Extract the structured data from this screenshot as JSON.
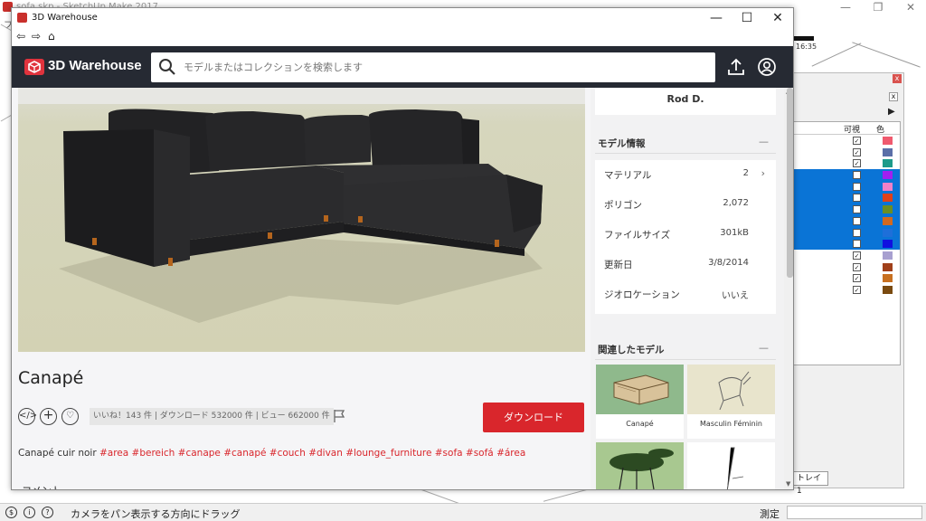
{
  "bg_app": {
    "title": "sofa.skp - SketchUp Make 2017",
    "menu_initial": "フ",
    "clock": "16:35",
    "controls": {
      "minimize": "—",
      "restore": "❐",
      "close": "✕"
    }
  },
  "tray": {
    "close": "x",
    "subclose": "x",
    "arrow": "▶",
    "col_visible": "可視",
    "col_color": "色",
    "tab_label": "トレイ 1",
    "layers": [
      {
        "visible": true,
        "color": "#f05a6e",
        "selected": false
      },
      {
        "visible": true,
        "color": "#5b6fa8",
        "selected": false
      },
      {
        "visible": true,
        "color": "#1e9b8a",
        "selected": false
      },
      {
        "visible": false,
        "color": "#a020f0",
        "selected": true
      },
      {
        "visible": false,
        "color": "#f080c8",
        "selected": true
      },
      {
        "visible": false,
        "color": "#e0401a",
        "selected": true
      },
      {
        "visible": false,
        "color": "#6b8e23",
        "selected": true
      },
      {
        "visible": false,
        "color": "#d2691e",
        "selected": true
      },
      {
        "visible": false,
        "color": "#1e6fd9",
        "selected": true
      },
      {
        "visible": false,
        "color": "#1010e0",
        "selected": true
      },
      {
        "visible": true,
        "color": "#a8a0d0",
        "selected": false
      },
      {
        "visible": true,
        "color": "#a0401a",
        "selected": false
      },
      {
        "visible": true,
        "color": "#c87020",
        "selected": false
      },
      {
        "visible": true,
        "color": "#7a4a10",
        "selected": false
      }
    ]
  },
  "statusbar": {
    "hint": "カメラをパン表示する方向にドラッグ",
    "measure_label": "測定",
    "icon1": "$",
    "icon2": "i",
    "icon3": "?"
  },
  "warehouse": {
    "window_title": "3D Warehouse",
    "controls": {
      "minimize": "—",
      "maximize": "☐",
      "close": "✕"
    },
    "nav": {
      "back": "⇦",
      "forward": "⇨",
      "home": "⌂"
    },
    "logo_text": "3D Warehouse",
    "search_placeholder": "モデルまたはコレクションを検索します",
    "model": {
      "title": "Canapé",
      "stats": "いいね！143 件 | ダウンロード 532000 件 | ビュー 662000 件",
      "download_label": "ダウンロード",
      "description_prefix": "Canapé cuir noir ",
      "tags": "#area #bereich #canape #canapé #couch #divan #lounge_furniture #sofa #sofá #área",
      "comment_title": "コメント"
    },
    "sidebar": {
      "author": "Rod D.",
      "info_title": "モデル情報",
      "collapse": "—",
      "info_rows": [
        {
          "label": "マテリアル",
          "value": "2",
          "chevron": "›"
        },
        {
          "label": "ポリゴン",
          "value": "2,072",
          "chevron": ""
        },
        {
          "label": "ファイルサイズ",
          "value": "301kB",
          "chevron": ""
        },
        {
          "label": "更新日",
          "value": "3/8/2014",
          "chevron": ""
        },
        {
          "label": "ジオロケーション",
          "value": "いいえ",
          "chevron": ""
        }
      ],
      "related_title": "関連したモデル",
      "related": [
        {
          "label": "Canapé"
        },
        {
          "label": "Masculin Féminin"
        },
        {
          "label": ""
        },
        {
          "label": ""
        }
      ]
    },
    "colors": {
      "header_bg": "#262a33",
      "accent_red": "#d9262c",
      "sofa": "#2a2a2c"
    }
  }
}
